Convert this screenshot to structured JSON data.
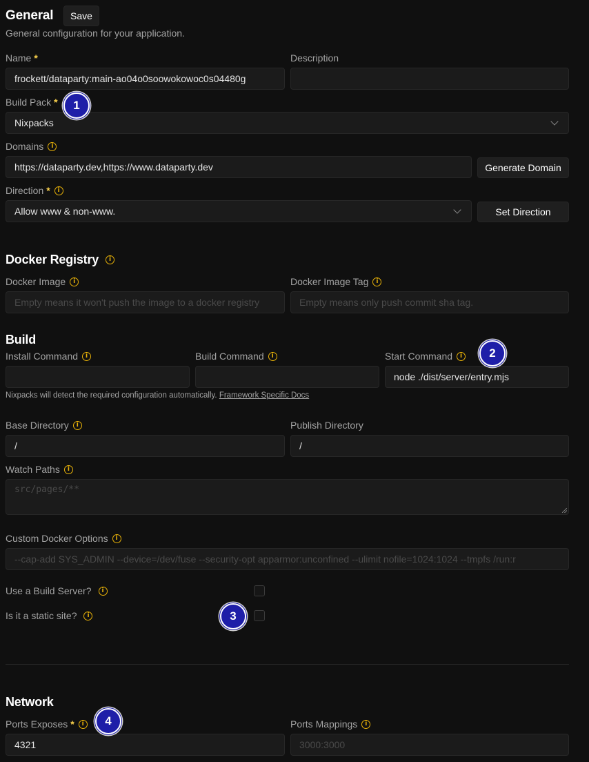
{
  "general": {
    "title": "General",
    "save_label": "Save",
    "subtitle": "General configuration for your application.",
    "name": {
      "label": "Name",
      "required": "*",
      "value": "frockett/dataparty:main-ao04o0soowokowoc0s04480g"
    },
    "description": {
      "label": "Description",
      "value": ""
    },
    "build_pack": {
      "label": "Build Pack",
      "required": "*",
      "value": "Nixpacks"
    },
    "domains": {
      "label": "Domains",
      "value": "https://dataparty.dev,https://www.dataparty.dev",
      "button": "Generate Domain"
    },
    "direction": {
      "label": "Direction",
      "required": "*",
      "value": "Allow www & non-www.",
      "button": "Set Direction"
    }
  },
  "docker_registry": {
    "title": "Docker Registry",
    "image": {
      "label": "Docker Image",
      "placeholder": "Empty means it won't push the image to a docker registry"
    },
    "tag": {
      "label": "Docker Image Tag",
      "placeholder": "Empty means only push commit sha tag."
    }
  },
  "build": {
    "title": "Build",
    "install": {
      "label": "Install Command",
      "value": ""
    },
    "build_cmd": {
      "label": "Build Command",
      "value": ""
    },
    "start": {
      "label": "Start Command",
      "value": "node ./dist/server/entry.mjs"
    },
    "helper_text": "Nixpacks will detect the required configuration automatically.",
    "helper_link": "Framework Specific Docs",
    "base_dir": {
      "label": "Base Directory",
      "value": "/"
    },
    "publish_dir": {
      "label": "Publish Directory",
      "value": "/"
    },
    "watch_paths": {
      "label": "Watch Paths",
      "placeholder": "src/pages/**"
    },
    "custom_docker": {
      "label": "Custom Docker Options",
      "placeholder": "--cap-add SYS_ADMIN --device=/dev/fuse --security-opt apparmor:unconfined --ulimit nofile=1024:1024 --tmpfs /run:r"
    },
    "build_server": {
      "label": "Use a Build Server?",
      "checked": false
    },
    "static_site": {
      "label": "Is it a static site?",
      "checked": false
    }
  },
  "network": {
    "title": "Network",
    "ports_exposes": {
      "label": "Ports Exposes",
      "required": "*",
      "value": "4321"
    },
    "ports_mappings": {
      "label": "Ports Mappings",
      "placeholder": "3000:3000"
    }
  },
  "annotations": [
    "1",
    "2",
    "3",
    "4"
  ],
  "icons": {
    "info": "i"
  },
  "colors": {
    "background": "#101010",
    "field": "#1b1b1b",
    "accent_info": "#eab308",
    "badge": "#1e1ea8"
  }
}
